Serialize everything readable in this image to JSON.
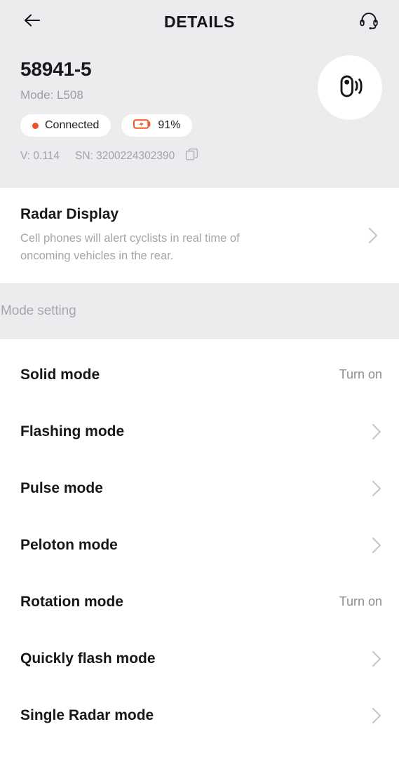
{
  "header": {
    "title": "DETAILS",
    "back_icon": "arrow-left-icon",
    "support_icon": "headset-icon"
  },
  "device": {
    "name": "58941-5",
    "mode_label": "Mode: L508",
    "avatar_icon": "radar-taillight-icon",
    "status_badge": {
      "label": "Connected",
      "dot_icon": "status-dot-icon",
      "dot_color": "#f05323"
    },
    "battery_badge": {
      "label": "91%",
      "icon": "battery-charging-icon",
      "icon_color": "#ee5a2b"
    },
    "version_label": "V: 0.114",
    "serial_label": "SN: 3200224302390",
    "copy_icon": "copy-icon"
  },
  "radar_display": {
    "title": "Radar Display",
    "subtitle": "Cell phones will alert cyclists in real time of oncoming vehicles in the rear.",
    "chevron_icon": "chevron-right-icon"
  },
  "mode_section": {
    "heading": "Mode setting",
    "items": [
      {
        "label": "Solid mode",
        "action": "Turn on",
        "type": "action"
      },
      {
        "label": "Flashing mode",
        "action": "",
        "type": "chevron",
        "chevron_icon": "chevron-right-icon"
      },
      {
        "label": "Pulse mode",
        "action": "",
        "type": "chevron",
        "chevron_icon": "chevron-right-icon"
      },
      {
        "label": "Peloton mode",
        "action": "",
        "type": "chevron",
        "chevron_icon": "chevron-right-icon"
      },
      {
        "label": "Rotation mode",
        "action": "Turn on",
        "type": "action"
      },
      {
        "label": "Quickly flash mode",
        "action": "",
        "type": "chevron",
        "chevron_icon": "chevron-right-icon"
      },
      {
        "label": "Single Radar mode",
        "action": "",
        "type": "chevron",
        "chevron_icon": "chevron-right-icon"
      }
    ]
  },
  "colors": {
    "background": "#ececee",
    "surface": "#ffffff",
    "accent": "#f05323",
    "text_primary": "#16171a",
    "text_secondary": "#a2a5ab"
  }
}
